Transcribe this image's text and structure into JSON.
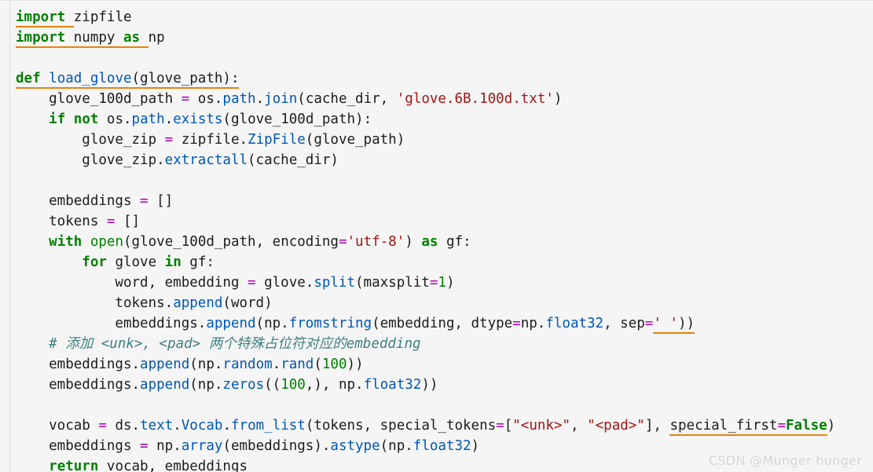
{
  "editor": {
    "language": "python",
    "background_color": "#f5f5f5",
    "text_color": "#1c1c1c",
    "colors": {
      "keyword": "#008000",
      "builtin": "#008000",
      "function": "#0057b7",
      "string": "#a31515",
      "number": "#008000",
      "operator": "#b000b0",
      "comment": "#3f7f7f",
      "spellcheck_underline": "#e8820c",
      "gutter_rule": "#dedede"
    }
  },
  "code": {
    "lines": [
      {
        "n": 1,
        "text": "import zipfile",
        "tokens": [
          {
            "t": "import",
            "c": "kw",
            "spell": true
          },
          {
            "t": " ",
            "c": "pln",
            "spell": true
          },
          {
            "t": "zipfile",
            "c": "pln",
            "spell": false
          }
        ]
      },
      {
        "n": 2,
        "text": "import numpy as np",
        "tokens": [
          {
            "t": "import",
            "c": "kw",
            "spell": true
          },
          {
            "t": " ",
            "c": "pln",
            "spell": true
          },
          {
            "t": "numpy",
            "c": "pln",
            "spell": true
          },
          {
            "t": " ",
            "c": "pln",
            "spell": true
          },
          {
            "t": "as",
            "c": "kw",
            "spell": true
          },
          {
            "t": " ",
            "c": "pln",
            "spell": true
          },
          {
            "t": "np",
            "c": "pln",
            "spell": false
          }
        ]
      },
      {
        "n": 3,
        "text": "",
        "tokens": []
      },
      {
        "n": 4,
        "text": "def load_glove(glove_path):",
        "tokens": [
          {
            "t": "def",
            "c": "kw",
            "spell": true
          },
          {
            "t": " ",
            "c": "pln",
            "spell": true
          },
          {
            "t": "load_glove",
            "c": "fn",
            "spell": true
          },
          {
            "t": "(glove_path):",
            "c": "pln",
            "spell": true
          }
        ]
      },
      {
        "n": 5,
        "text": "    glove_100d_path = os.path.join(cache_dir, 'glove.6B.100d.txt')",
        "tokens": [
          {
            "t": "    glove_100d_path ",
            "c": "pln",
            "spell": false
          },
          {
            "t": "=",
            "c": "op",
            "spell": false
          },
          {
            "t": " os.",
            "c": "pln",
            "spell": false
          },
          {
            "t": "path",
            "c": "fn",
            "spell": false
          },
          {
            "t": ".",
            "c": "pln",
            "spell": false
          },
          {
            "t": "join",
            "c": "fn",
            "spell": false
          },
          {
            "t": "(cache_dir, ",
            "c": "pln",
            "spell": false
          },
          {
            "t": "'glove.6B.100d.txt'",
            "c": "str",
            "spell": false
          },
          {
            "t": ")",
            "c": "pln",
            "spell": false
          }
        ]
      },
      {
        "n": 6,
        "text": "    if not os.path.exists(glove_100d_path):",
        "tokens": [
          {
            "t": "    ",
            "c": "pln",
            "spell": false
          },
          {
            "t": "if",
            "c": "kw",
            "spell": false
          },
          {
            "t": " ",
            "c": "pln",
            "spell": false
          },
          {
            "t": "not",
            "c": "kw",
            "spell": false
          },
          {
            "t": " os.",
            "c": "pln",
            "spell": false
          },
          {
            "t": "path",
            "c": "fn",
            "spell": false
          },
          {
            "t": ".",
            "c": "pln",
            "spell": false
          },
          {
            "t": "exists",
            "c": "fn",
            "spell": false
          },
          {
            "t": "(glove_100d_path):",
            "c": "pln",
            "spell": false
          }
        ]
      },
      {
        "n": 7,
        "text": "        glove_zip = zipfile.ZipFile(glove_path)",
        "tokens": [
          {
            "t": "        glove_zip ",
            "c": "pln",
            "spell": false
          },
          {
            "t": "=",
            "c": "op",
            "spell": false
          },
          {
            "t": " zipfile.",
            "c": "pln",
            "spell": false
          },
          {
            "t": "ZipFile",
            "c": "cls",
            "spell": false
          },
          {
            "t": "(glove_path)",
            "c": "pln",
            "spell": false
          }
        ]
      },
      {
        "n": 8,
        "text": "        glove_zip.extractall(cache_dir)",
        "tokens": [
          {
            "t": "        glove_zip.",
            "c": "pln",
            "spell": false
          },
          {
            "t": "extractall",
            "c": "fn",
            "spell": false
          },
          {
            "t": "(cache_dir)",
            "c": "pln",
            "spell": false
          }
        ]
      },
      {
        "n": 9,
        "text": "",
        "tokens": []
      },
      {
        "n": 10,
        "text": "    embeddings = []",
        "tokens": [
          {
            "t": "    embeddings ",
            "c": "pln",
            "spell": false
          },
          {
            "t": "=",
            "c": "op",
            "spell": false
          },
          {
            "t": " []",
            "c": "pln",
            "spell": false
          }
        ]
      },
      {
        "n": 11,
        "text": "    tokens = []",
        "tokens": [
          {
            "t": "    tokens ",
            "c": "pln",
            "spell": false
          },
          {
            "t": "=",
            "c": "op",
            "spell": false
          },
          {
            "t": " []",
            "c": "pln",
            "spell": false
          }
        ]
      },
      {
        "n": 12,
        "text": "    with open(glove_100d_path, encoding='utf-8') as gf:",
        "tokens": [
          {
            "t": "    ",
            "c": "pln",
            "spell": false
          },
          {
            "t": "with",
            "c": "kw",
            "spell": false
          },
          {
            "t": " ",
            "c": "pln",
            "spell": false
          },
          {
            "t": "open",
            "c": "bi",
            "spell": false
          },
          {
            "t": "(glove_100d_path, encoding",
            "c": "pln",
            "spell": false
          },
          {
            "t": "=",
            "c": "op",
            "spell": false
          },
          {
            "t": "'utf-8'",
            "c": "str",
            "spell": false
          },
          {
            "t": ") ",
            "c": "pln",
            "spell": false
          },
          {
            "t": "as",
            "c": "kw",
            "spell": false
          },
          {
            "t": " gf:",
            "c": "pln",
            "spell": false
          }
        ]
      },
      {
        "n": 13,
        "text": "        for glove in gf:",
        "tokens": [
          {
            "t": "        ",
            "c": "pln",
            "spell": false
          },
          {
            "t": "for",
            "c": "kw",
            "spell": false
          },
          {
            "t": " glove ",
            "c": "pln",
            "spell": false
          },
          {
            "t": "in",
            "c": "kw",
            "spell": false
          },
          {
            "t": " gf:",
            "c": "pln",
            "spell": false
          }
        ]
      },
      {
        "n": 14,
        "text": "            word, embedding = glove.split(maxsplit=1)",
        "tokens": [
          {
            "t": "            word, embedding ",
            "c": "pln",
            "spell": false
          },
          {
            "t": "=",
            "c": "op",
            "spell": false
          },
          {
            "t": " glove.",
            "c": "pln",
            "spell": false
          },
          {
            "t": "split",
            "c": "fn",
            "spell": false
          },
          {
            "t": "(maxsplit",
            "c": "pln",
            "spell": false
          },
          {
            "t": "=",
            "c": "op",
            "spell": false
          },
          {
            "t": "1",
            "c": "num",
            "spell": false
          },
          {
            "t": ")",
            "c": "pln",
            "spell": false
          }
        ]
      },
      {
        "n": 15,
        "text": "            tokens.append(word)",
        "tokens": [
          {
            "t": "            tokens.",
            "c": "pln",
            "spell": false
          },
          {
            "t": "append",
            "c": "fn",
            "spell": false
          },
          {
            "t": "(word)",
            "c": "pln",
            "spell": false
          }
        ]
      },
      {
        "n": 16,
        "text": "            embeddings.append(np.fromstring(embedding, dtype=np.float32, sep=' '))",
        "tokens": [
          {
            "t": "            embeddings.",
            "c": "pln",
            "spell": false
          },
          {
            "t": "append",
            "c": "fn",
            "spell": false
          },
          {
            "t": "(np.",
            "c": "pln",
            "spell": false
          },
          {
            "t": "fromstring",
            "c": "fn",
            "spell": false
          },
          {
            "t": "(embedding, dtype",
            "c": "pln",
            "spell": false
          },
          {
            "t": "=",
            "c": "op",
            "spell": false
          },
          {
            "t": "np.",
            "c": "pln",
            "spell": false
          },
          {
            "t": "float32",
            "c": "fn",
            "spell": false
          },
          {
            "t": ", sep",
            "c": "pln",
            "spell": false
          },
          {
            "t": "=",
            "c": "op",
            "spell": false
          },
          {
            "t": "' '",
            "c": "str",
            "spell": true
          },
          {
            "t": "))",
            "c": "pln",
            "spell": true
          }
        ]
      },
      {
        "n": 17,
        "text": "    # 添加 <unk>, <pad> 两个特殊占位符对应的embedding",
        "tokens": [
          {
            "t": "    # 添加 <unk>, <pad> 两个特殊占位符对应的embedding",
            "c": "cmt",
            "spell": false
          }
        ]
      },
      {
        "n": 18,
        "text": "    embeddings.append(np.random.rand(100))",
        "tokens": [
          {
            "t": "    embeddings.",
            "c": "pln",
            "spell": false
          },
          {
            "t": "append",
            "c": "fn",
            "spell": false
          },
          {
            "t": "(np.",
            "c": "pln",
            "spell": false
          },
          {
            "t": "random",
            "c": "fn",
            "spell": false
          },
          {
            "t": ".",
            "c": "pln",
            "spell": false
          },
          {
            "t": "rand",
            "c": "fn",
            "spell": false
          },
          {
            "t": "(",
            "c": "pln",
            "spell": false
          },
          {
            "t": "100",
            "c": "num",
            "spell": false
          },
          {
            "t": "))",
            "c": "pln",
            "spell": false
          }
        ]
      },
      {
        "n": 19,
        "text": "    embeddings.append(np.zeros((100,), np.float32))",
        "tokens": [
          {
            "t": "    embeddings.",
            "c": "pln",
            "spell": false
          },
          {
            "t": "append",
            "c": "fn",
            "spell": false
          },
          {
            "t": "(np.",
            "c": "pln",
            "spell": false
          },
          {
            "t": "zeros",
            "c": "fn",
            "spell": false
          },
          {
            "t": "((",
            "c": "pln",
            "spell": false
          },
          {
            "t": "100",
            "c": "num",
            "spell": false
          },
          {
            "t": ",), np.",
            "c": "pln",
            "spell": false
          },
          {
            "t": "float32",
            "c": "fn",
            "spell": false
          },
          {
            "t": "))",
            "c": "pln",
            "spell": false
          }
        ]
      },
      {
        "n": 20,
        "text": "",
        "tokens": []
      },
      {
        "n": 21,
        "text": "    vocab = ds.text.Vocab.from_list(tokens, special_tokens=[\"<unk>\", \"<pad>\"], special_first=False)",
        "tokens": [
          {
            "t": "    vocab ",
            "c": "pln",
            "spell": false
          },
          {
            "t": "=",
            "c": "op",
            "spell": false
          },
          {
            "t": " ds.",
            "c": "pln",
            "spell": false
          },
          {
            "t": "text",
            "c": "fn",
            "spell": false
          },
          {
            "t": ".",
            "c": "pln",
            "spell": false
          },
          {
            "t": "Vocab",
            "c": "cls",
            "spell": false
          },
          {
            "t": ".",
            "c": "pln",
            "spell": false
          },
          {
            "t": "from_list",
            "c": "fn",
            "spell": false
          },
          {
            "t": "(tokens, special_tokens",
            "c": "pln",
            "spell": false
          },
          {
            "t": "=",
            "c": "op",
            "spell": false
          },
          {
            "t": "[",
            "c": "pln",
            "spell": false
          },
          {
            "t": "\"<unk>\"",
            "c": "str",
            "spell": false
          },
          {
            "t": ", ",
            "c": "pln",
            "spell": false
          },
          {
            "t": "\"<pad>\"",
            "c": "str",
            "spell": false
          },
          {
            "t": "], ",
            "c": "pln",
            "spell": false
          },
          {
            "t": "special_first",
            "c": "pln",
            "spell": true
          },
          {
            "t": "=",
            "c": "op",
            "spell": true
          },
          {
            "t": "False",
            "c": "const",
            "spell": true
          },
          {
            "t": ")",
            "c": "pln",
            "spell": false
          }
        ]
      },
      {
        "n": 22,
        "text": "    embeddings = np.array(embeddings).astype(np.float32)",
        "tokens": [
          {
            "t": "    embeddings ",
            "c": "pln",
            "spell": false
          },
          {
            "t": "=",
            "c": "op",
            "spell": false
          },
          {
            "t": " np.",
            "c": "pln",
            "spell": false
          },
          {
            "t": "array",
            "c": "fn",
            "spell": false
          },
          {
            "t": "(embeddings).",
            "c": "pln",
            "spell": false
          },
          {
            "t": "astype",
            "c": "fn",
            "spell": false
          },
          {
            "t": "(np.",
            "c": "pln",
            "spell": false
          },
          {
            "t": "float32",
            "c": "fn",
            "spell": false
          },
          {
            "t": ")",
            "c": "pln",
            "spell": false
          }
        ]
      },
      {
        "n": 23,
        "text": "    return vocab, embeddings",
        "tokens": [
          {
            "t": "    ",
            "c": "pln",
            "spell": false
          },
          {
            "t": "return",
            "c": "kw",
            "spell": false
          },
          {
            "t": " vocab, embeddings",
            "c": "pln",
            "spell": false
          }
        ]
      }
    ]
  },
  "watermark": {
    "text": "CSDN @Munger hunger"
  }
}
